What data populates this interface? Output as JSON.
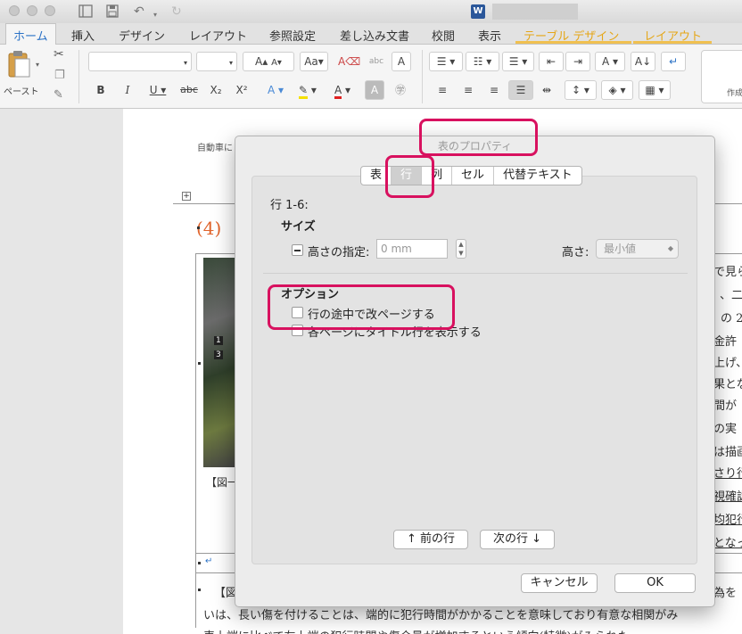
{
  "ribbon": {
    "tabs": [
      "ホーム",
      "挿入",
      "デザイン",
      "レイアウト",
      "参照設定",
      "差し込み文書",
      "校閲",
      "表示"
    ],
    "contextual_tabs": [
      "テーブル デザイン",
      "レイアウト"
    ],
    "paste_label": "ペースト",
    "styles_label": "作成"
  },
  "document": {
    "header_text": "自動車に",
    "heading": "(4)",
    "caption": "【図一",
    "right_lines": [
      "で見ら",
      "、二",
      "の 2",
      "金許",
      "上げ、",
      "果とな",
      "間が",
      "の実",
      "は描画",
      "さり行",
      "視確認",
      "均犯行",
      "となっ"
    ],
    "bottom_lines": [
      "【図",
      "為を",
      "いは、長い傷を付けることは、端的に犯行時間がかかることを意味しており有意な相関がみ",
      "表上端に比べて左上端の犯行時間や傷合量が増加するという傾向(特徴)がみられた。"
    ],
    "photo_numbers": [
      "1",
      "3"
    ]
  },
  "dialog": {
    "title": "表のプロパティ",
    "tabs": [
      "表",
      "行",
      "列",
      "セル",
      "代替テキスト"
    ],
    "selected_tab": "行",
    "row_range": "行 1-6:",
    "size_label": "サイズ",
    "height_checkbox": "高さの指定:",
    "height_value": "0 mm",
    "height_rule_label": "高さ:",
    "height_rule_value": "最小値",
    "options_label": "オプション",
    "option_1": "行の途中で改ページする",
    "option_2": "各ページにタイトル行を表示する",
    "prev_row": "↑ 前の行",
    "next_row": "次の行 ↓",
    "cancel": "キャンセル",
    "ok": "OK"
  },
  "colors": {
    "highlight": "#d8115f",
    "active_tab": "#2b72c6",
    "contextual_tab": "#e5a617",
    "heading": "#e0642c"
  }
}
